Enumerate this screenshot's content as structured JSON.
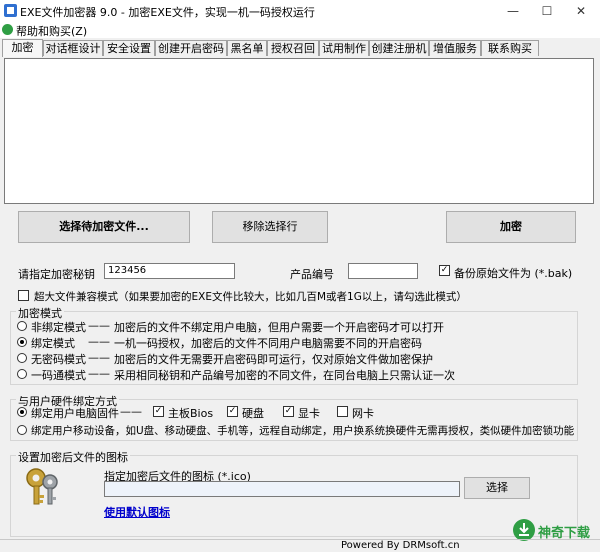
{
  "window": {
    "title": "EXE文件加密器 9.0 - 加密EXE文件，实现一机一码授权运行"
  },
  "menu": {
    "items": [
      {
        "label": "帮助和购买(Z)"
      }
    ]
  },
  "tabs": [
    {
      "label": "加密"
    },
    {
      "label": "对话框设计"
    },
    {
      "label": "安全设置"
    },
    {
      "label": "创建开启密码"
    },
    {
      "label": "黑名单"
    },
    {
      "label": "授权召回"
    },
    {
      "label": "试用制作"
    },
    {
      "label": "创建注册机"
    },
    {
      "label": "增值服务"
    },
    {
      "label": "联系购买"
    }
  ],
  "buttons": {
    "select_file": "选择待加密文件...",
    "remove_selected": "移除选择行",
    "encrypt": "加密",
    "choose_icon": "选择"
  },
  "fields": {
    "key_label": "请指定加密秘钥",
    "key_value": "123456",
    "product_label": "产品编号",
    "product_value": "",
    "backup_label": "备份原始文件为 (*.bak)",
    "backup_checked": true
  },
  "large_file": {
    "label": "超大文件兼容模式（如果要加密的EXE文件比较大，比如几百M或者1G以上，请勾选此模式）",
    "checked": false
  },
  "encrypt_mode": {
    "legend": "加密模式",
    "options": [
      {
        "name": "非绑定模式",
        "desc": "加密后的文件不绑定用户电脑，但用户需要一个开启密码才可以打开",
        "selected": false
      },
      {
        "name": "绑定模式",
        "desc": "一机一码授权，加密后的文件不同用户电脑需要不同的开启密码",
        "selected": true
      },
      {
        "name": "无密码模式",
        "desc": "加密后的文件无需要开启密码即可运行，仅对原始文件做加密保护",
        "selected": false
      },
      {
        "name": "一码通模式",
        "desc": "采用相同秘钥和产品编号加密的不同文件，在同台电脑上只需认证一次",
        "selected": false
      }
    ]
  },
  "hardware_bind": {
    "legend": "与用户硬件绑定方式",
    "pc_option": "绑定用户电脑固件",
    "pc_selected": true,
    "parts": [
      {
        "label": "主板Bios",
        "checked": true
      },
      {
        "label": "硬盘",
        "checked": true
      },
      {
        "label": "显卡",
        "checked": true
      },
      {
        "label": "网卡",
        "checked": false
      }
    ],
    "mobile_option": "绑定用户移动设备，如U盘、移动硬盘、手机等，远程自动绑定，用户换系统换硬件无需再授权，类似硬件加密锁功能",
    "mobile_selected": false
  },
  "icon_settings": {
    "legend": "设置加密后文件的图标",
    "path_label": "指定加密后文件的图标 (*.ico)",
    "path_value": "",
    "default_link": "使用默认图标"
  },
  "status": {
    "text": "Powered By DRMsoft.cn"
  },
  "watermark": {
    "text": "神奇下载"
  },
  "colors": {
    "accent": "#2f9e44",
    "link": "#0000cc"
  }
}
